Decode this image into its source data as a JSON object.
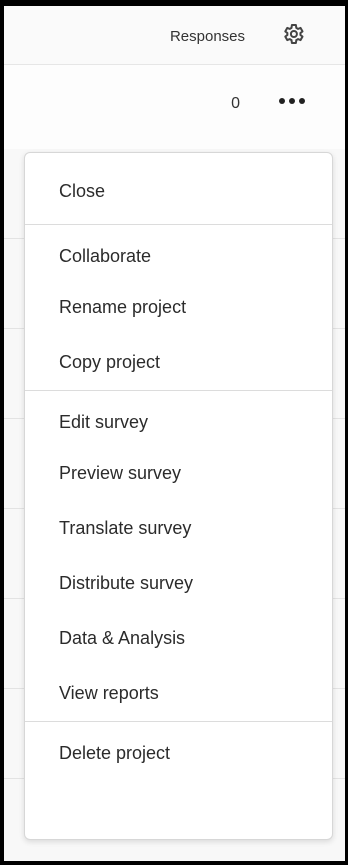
{
  "header": {
    "responses_label": "Responses",
    "settings_icon": "gear-icon"
  },
  "row": {
    "response_count": "0",
    "more_icon": "more-horizontal-icon"
  },
  "menu": {
    "close": "Close",
    "collaborate": "Collaborate",
    "rename": "Rename project",
    "copy": "Copy project",
    "edit": "Edit survey",
    "preview": "Preview survey",
    "translate": "Translate survey",
    "distribute": "Distribute survey",
    "data_analysis": "Data & Analysis",
    "view_reports": "View reports",
    "delete": "Delete project"
  }
}
